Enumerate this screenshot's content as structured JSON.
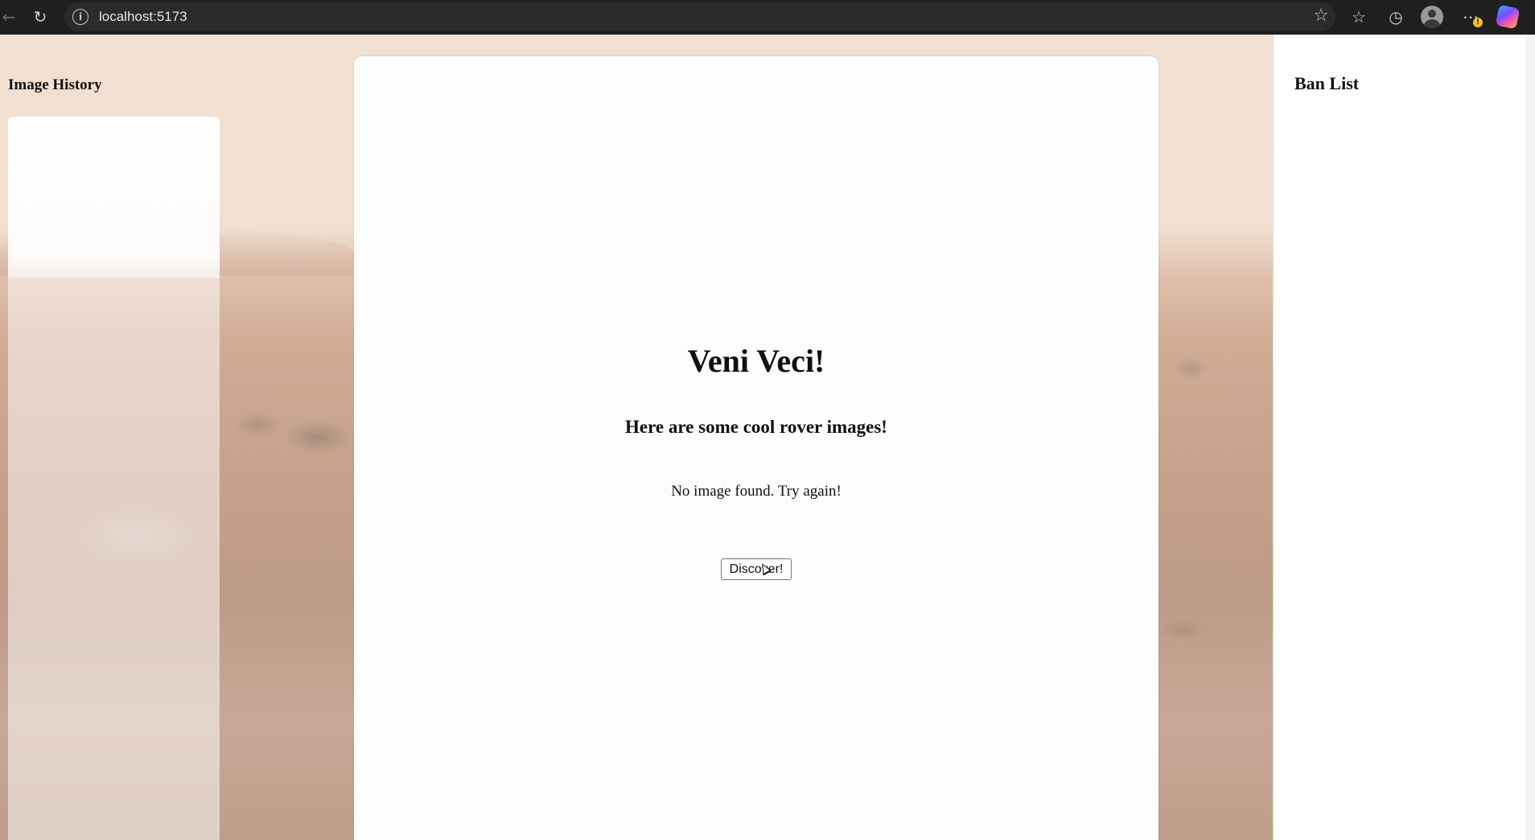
{
  "browser": {
    "url": "localhost:5173",
    "icons": {
      "back": "arrow-left-icon",
      "reload": "reload-icon",
      "site_info": "info-icon",
      "bookmark": "star-icon",
      "favorites": "favorites-icon",
      "history": "history-icon",
      "profile": "profile-icon",
      "more": "more-icon",
      "copilot": "copilot-icon"
    }
  },
  "sidebar": {
    "title": "Image History"
  },
  "main": {
    "title": "Veni Veci!",
    "subtitle": "Here are some cool rover images!",
    "status": "No image found. Try again!",
    "discover_label": "Discover!"
  },
  "ban_list": {
    "title": "Ban List"
  },
  "colors": {
    "chrome_bg": "#1f1f1f",
    "card_bg": "#fdfdfd",
    "mars_sky": "#f2e1d4",
    "mars_ground": "#bd957d"
  }
}
